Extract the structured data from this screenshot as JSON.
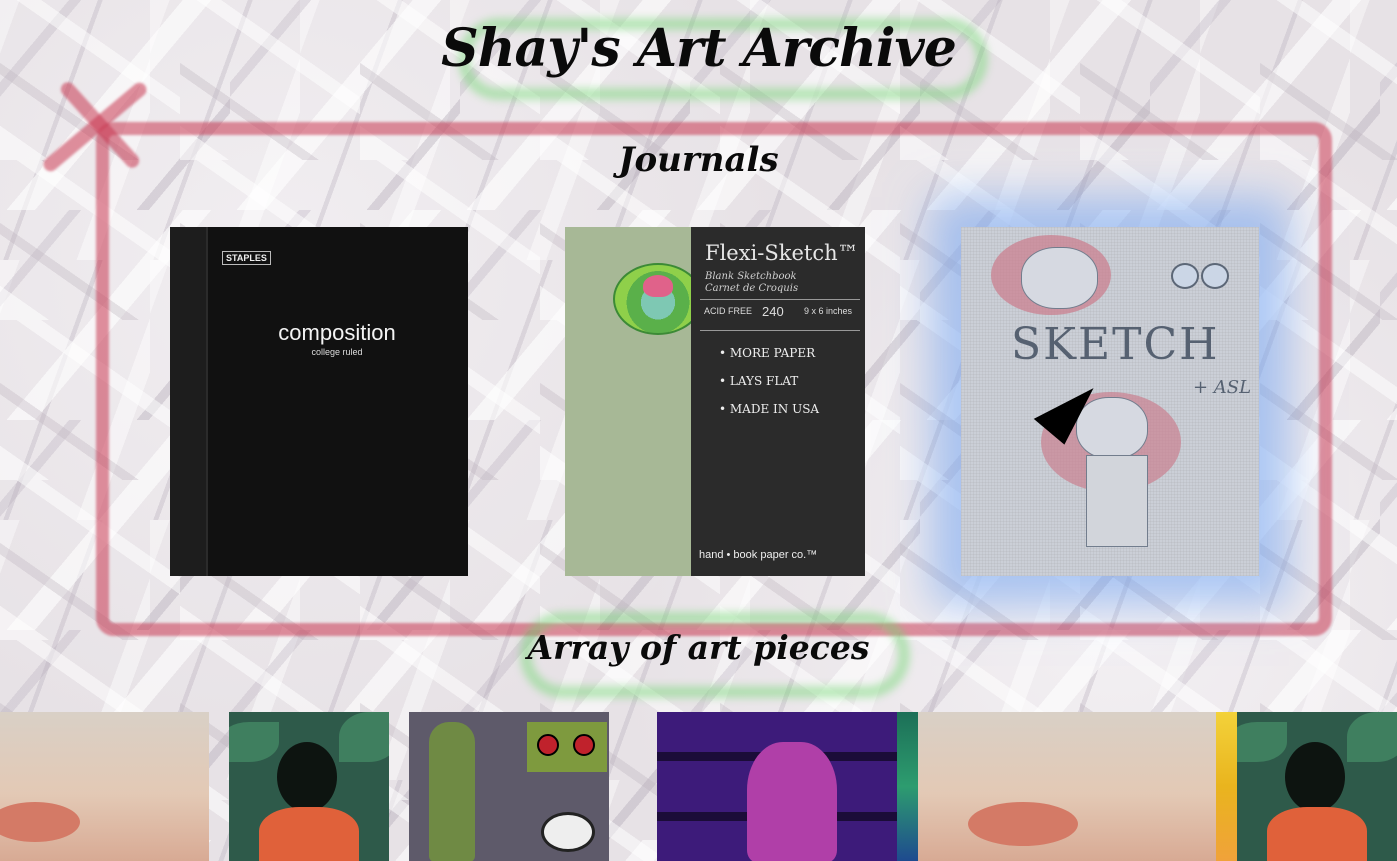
{
  "site": {
    "title": "Shay's Art Archive"
  },
  "sections": {
    "journals_title": "Journals",
    "array_title": "Array of art pieces"
  },
  "journals": [
    {
      "name": "Composition notebook",
      "brand": "STAPLES",
      "cover_title": "composition",
      "cover_subtitle": "college ruled"
    },
    {
      "name": "Flexi-Sketch sketchbook",
      "cover_title": "Flexi-Sketch™",
      "cover_subtitle_1": "Blank Sketchbook",
      "cover_subtitle_2": "Carnet de Croquis",
      "spec_acid": "ACID FREE",
      "spec_sheets": "240",
      "spec_size": "9 x 6 inches",
      "bullets": [
        "• MORE PAPER",
        "• LAYS FLAT",
        "• MADE IN USA"
      ],
      "brandline": "hand • book paper co.™"
    },
    {
      "name": "Sketch + ASL journal",
      "cover_word": "SKETCH",
      "cover_extra": "+ ASL",
      "selected": true
    }
  ],
  "art_pieces": [
    {
      "name": "lips-painting"
    },
    {
      "name": "faceless-figure-leaves"
    },
    {
      "name": "character-sheet"
    },
    {
      "name": "purple-window-figure"
    },
    {
      "name": "teal-painting"
    },
    {
      "name": "lips-painting-2"
    },
    {
      "name": "yellow-painting"
    },
    {
      "name": "faceless-figure-leaves-2"
    }
  ],
  "colors": {
    "frame": "#c83750",
    "title_highlight": "#6ed76e",
    "selected_glow": "#6ea0f0",
    "background": "#e7e2e6"
  }
}
